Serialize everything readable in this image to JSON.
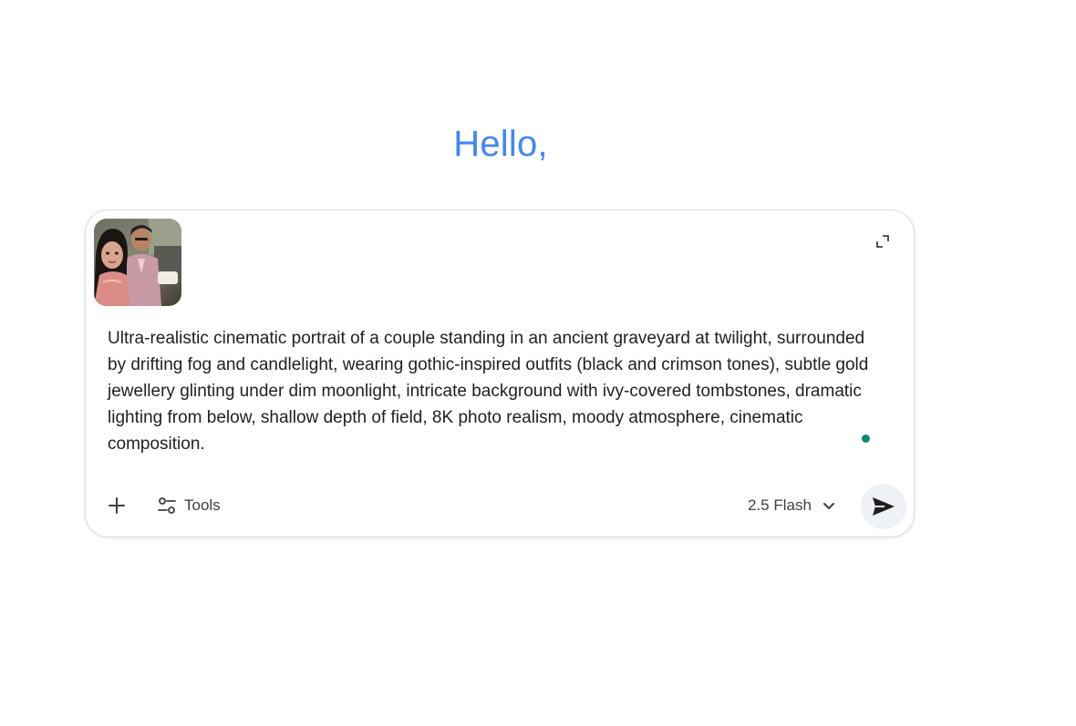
{
  "greeting": "Hello,",
  "prompt": {
    "text": "Ultra-realistic cinematic portrait of a couple standing in an ancient graveyard at twilight, surrounded by drifting fog and candlelight, wearing gothic-inspired outfits (black and crimson tones), subtle gold jewellery glinting under dim moonlight, intricate background with ivy-covered tombstones, dramatic lighting from below, shallow depth of field, 8K photo realism, moody atmosphere, cinematic composition."
  },
  "attachment": {
    "icon": "photo-thumbnail"
  },
  "toolbar": {
    "add_icon": "plus-icon",
    "tools_label": "Tools",
    "tools_icon": "tools-sliders-icon",
    "model_label": "2.5 Flash",
    "model_icon": "chevron-down-icon",
    "send_icon": "send-icon",
    "expand_icon": "expand-icon"
  },
  "colors": {
    "greeting": "#4285f4",
    "cursor_dot": "#0b8a74",
    "send_bg": "#eef1f6"
  }
}
